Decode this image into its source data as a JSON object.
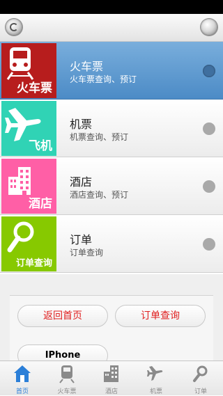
{
  "menu": {
    "items": [
      {
        "tile_label": "火车票",
        "title": "火车票",
        "subtitle": "火车票查询、预订",
        "tile_color": "#b71d1d"
      },
      {
        "tile_label": "飞机",
        "title": "机票",
        "subtitle": "机票查询、预订",
        "tile_color": "#30d3b5"
      },
      {
        "tile_label": "酒店",
        "title": "酒店",
        "subtitle": "酒店查询、预订",
        "tile_color": "#ff5fa6"
      },
      {
        "tile_label": "订单查询",
        "title": "订单",
        "subtitle": "订单查询",
        "tile_color": "#87c900"
      }
    ]
  },
  "buttons": {
    "home": "返回首页",
    "order_query": "订单查询",
    "iphone": "IPhone"
  },
  "tabbar": {
    "items": [
      {
        "label": "首页",
        "icon": "home-icon"
      },
      {
        "label": "火车票",
        "icon": "train-icon"
      },
      {
        "label": "酒店",
        "icon": "hotel-icon"
      },
      {
        "label": "机票",
        "icon": "airplane-icon"
      },
      {
        "label": "订单",
        "icon": "search-icon"
      }
    ],
    "active_color": "#2b7fd8"
  }
}
